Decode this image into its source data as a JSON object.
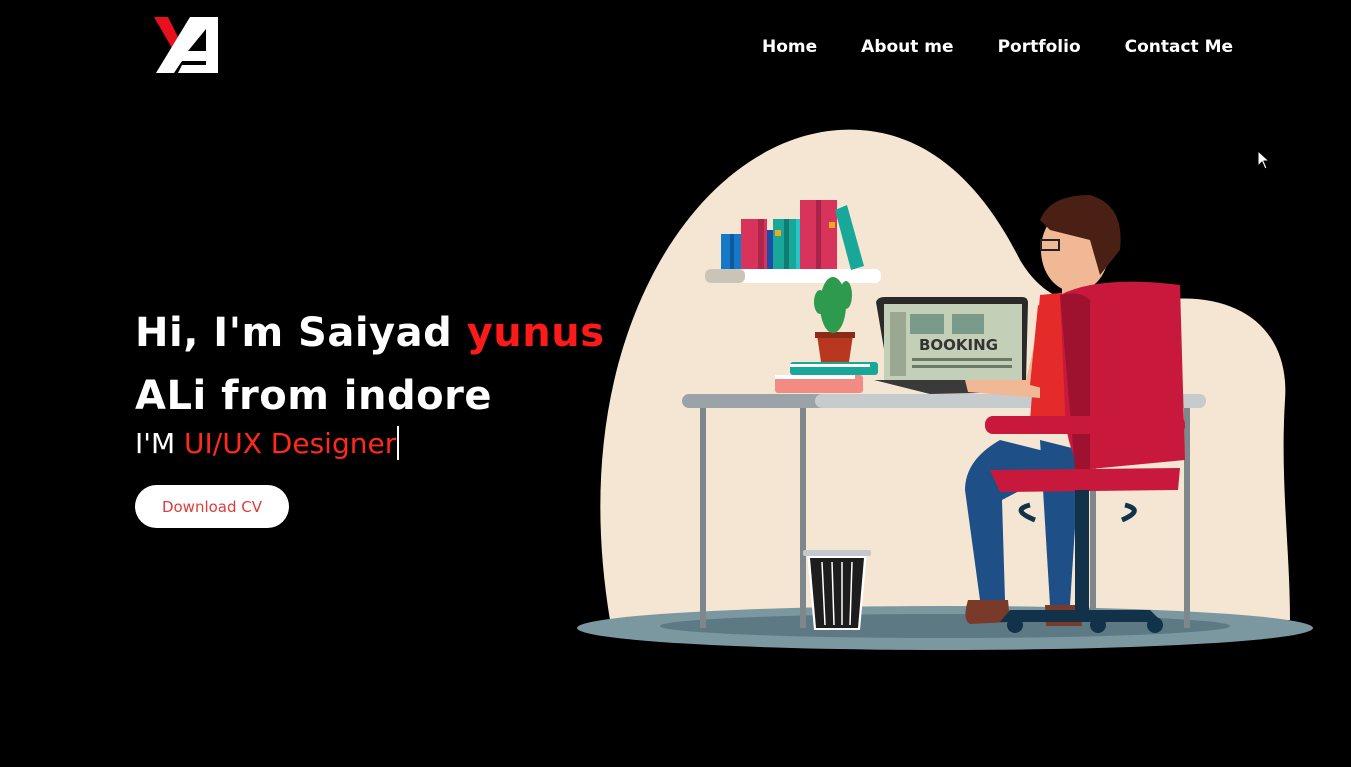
{
  "logo": {
    "icon": "ya-monogram-logo",
    "colors": {
      "primary": "#ffffff",
      "accent": "#e8101a"
    }
  },
  "nav": {
    "items": [
      {
        "label": "Home"
      },
      {
        "label": "About me"
      },
      {
        "label": "Portfolio"
      },
      {
        "label": "Contact Me"
      }
    ]
  },
  "hero": {
    "title_prefix": "Hi, I'm Saiyad",
    "title_accent": "yunus",
    "title_suffix": "ALi from indore",
    "subtitle_prefix": "I'M",
    "subtitle_accent": "UI/UX Designer",
    "cv_button": "Download CV"
  },
  "illustration": {
    "laptop_screen_text": "BOOKING",
    "icon": "person-working-at-desk-illustration"
  },
  "colors": {
    "background": "#000000",
    "accent": "#ff1a1a",
    "blob": "#f5e6d3",
    "chair": "#c8193c"
  }
}
